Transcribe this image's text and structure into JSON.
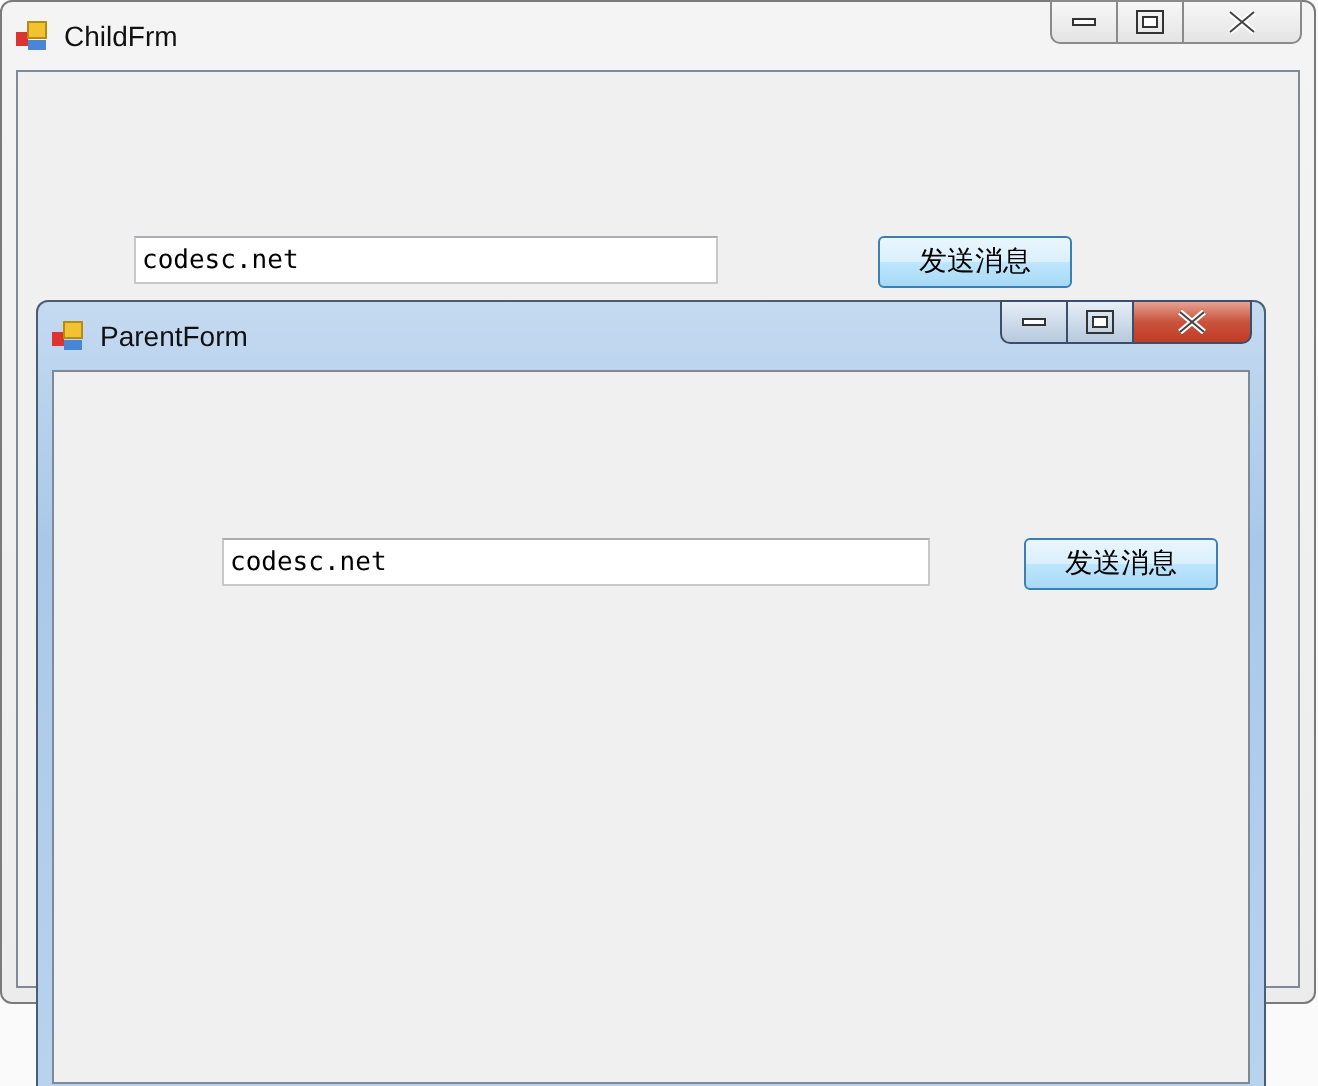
{
  "windows": [
    {
      "title": "ChildFrm",
      "active": false,
      "textbox": {
        "value": "codesc.net"
      },
      "button": "发送消息"
    },
    {
      "title": "ParentForm",
      "active": true,
      "textbox": {
        "value": "codesc.net"
      },
      "button": "发送消息"
    }
  ]
}
